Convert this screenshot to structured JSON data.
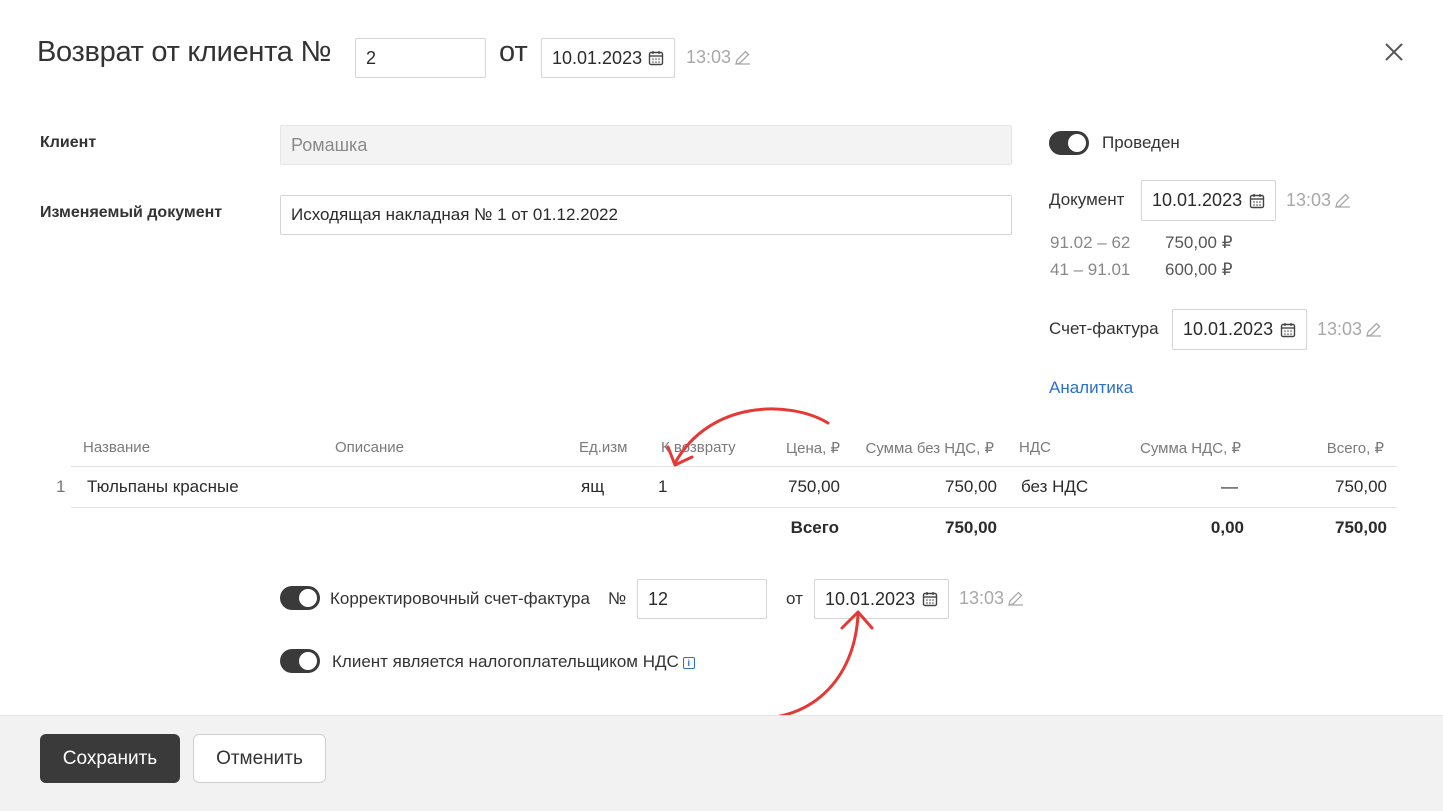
{
  "header": {
    "title": "Возврат от клиента №",
    "number": "2",
    "ot": "от",
    "date": "10.01.2023",
    "time": "13:03"
  },
  "form": {
    "client_label": "Клиент",
    "client_value": "Ромашка",
    "doc_label": "Изменяемый документ",
    "doc_value": "Исходящая накладная № 1 от 01.12.2022"
  },
  "side": {
    "posted_label": "Проведен",
    "posted": true,
    "document_label": "Документ",
    "document_date": "10.01.2023",
    "document_time": "13:03",
    "entries": [
      {
        "account": "91.02 – 62",
        "amount": "750,00 ₽"
      },
      {
        "account": "41 – 91.01",
        "amount": "600,00 ₽"
      }
    ],
    "invoice_label": "Счет-фактура",
    "invoice_date": "10.01.2023",
    "invoice_time": "13:03",
    "analytics_link": "Аналитика"
  },
  "table": {
    "headers": {
      "name": "Название",
      "desc": "Описание",
      "unit": "Ед.изм",
      "qty": "К возврату",
      "price": "Цена, ₽",
      "sum_no_vat": "Сумма без НДС, ₽",
      "vat": "НДС",
      "vat_sum": "Сумма НДС, ₽",
      "total": "Всего, ₽"
    },
    "rows": [
      {
        "n": "1",
        "name": "Тюльпаны красные",
        "desc": "",
        "unit": "ящ",
        "qty": "1",
        "price": "750,00",
        "sum_no_vat": "750,00",
        "vat": "без НДС",
        "vat_sum": "—",
        "total": "750,00"
      }
    ],
    "totals": {
      "label": "Всего",
      "sum_no_vat": "750,00",
      "vat_sum": "0,00",
      "total": "750,00"
    }
  },
  "correction": {
    "enabled": true,
    "label": "Корректировочный счет-фактура",
    "num_sign": "№",
    "number": "12",
    "ot": "от",
    "date": "10.01.2023",
    "time": "13:03"
  },
  "vat_payer": {
    "enabled": true,
    "label": "Клиент является налогоплательщиком НДС",
    "info": "i"
  },
  "footer": {
    "save": "Сохранить",
    "cancel": "Отменить"
  },
  "colors": {
    "accent_link": "#2b6fcf",
    "toggle_on": "#3a3a3a",
    "primary_button": "#3a3a3a",
    "annotation_arrow": "#e53935"
  }
}
